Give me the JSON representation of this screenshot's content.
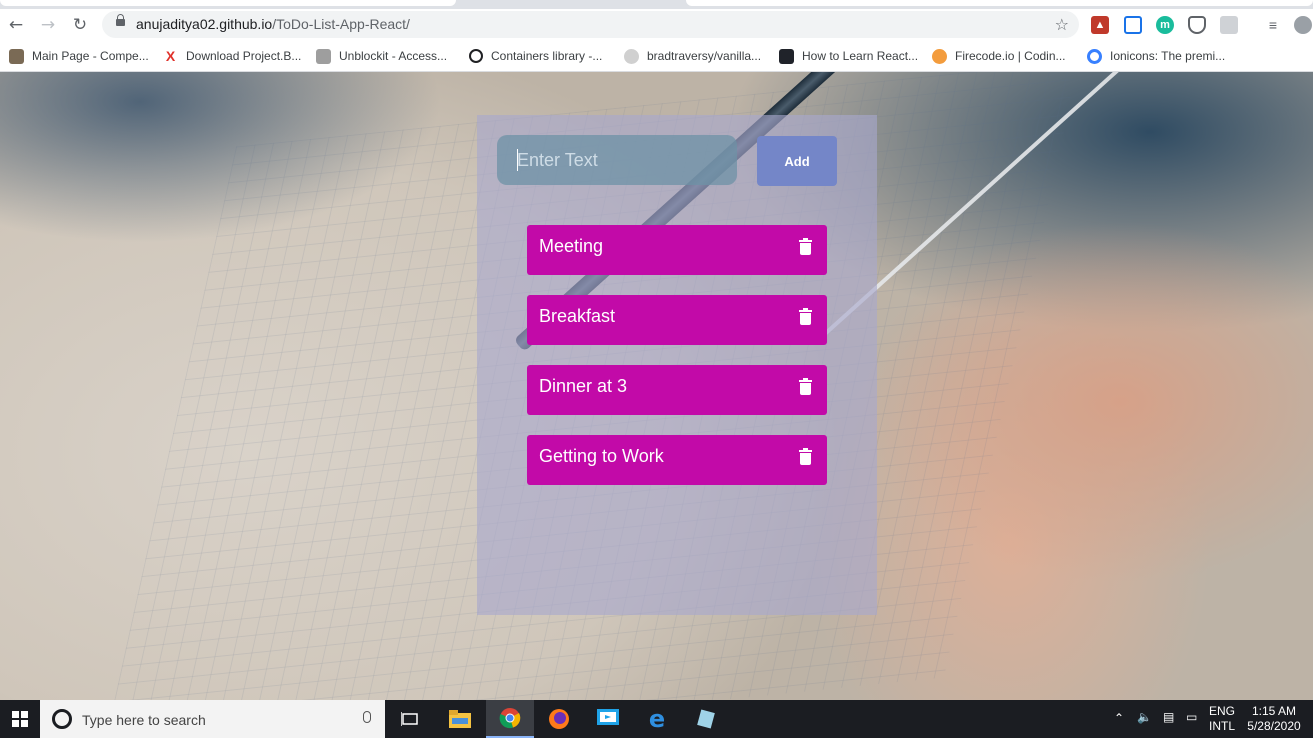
{
  "browser": {
    "url_host": "anujaditya02.github.io",
    "url_path": "/ToDo-List-App-React/",
    "bookmarks": [
      {
        "label": "Main Page - Compe...",
        "icon": "wiki-icon"
      },
      {
        "label": "Download Project.B...",
        "icon": "x-logo-icon"
      },
      {
        "label": "Unblockit - Access...",
        "icon": "unblockit-icon"
      },
      {
        "label": "Containers library -...",
        "icon": "containers-icon"
      },
      {
        "label": "bradtraversy/vanilla...",
        "icon": "github-icon"
      },
      {
        "label": "How to Learn React...",
        "icon": "react-icon"
      },
      {
        "label": "Firecode.io | Codin...",
        "icon": "firecode-icon"
      },
      {
        "label": "Ionicons: The premi...",
        "icon": "ionicons-icon"
      }
    ]
  },
  "todo": {
    "input_placeholder": "Enter Text",
    "add_label": "Add",
    "items": [
      {
        "text": "Meeting"
      },
      {
        "text": "Breakfast"
      },
      {
        "text": "Dinner at 3"
      },
      {
        "text": "Getting to Work"
      }
    ],
    "item_color": "#c20aa8",
    "button_color": "#7486c8"
  },
  "taskbar": {
    "search_placeholder": "Type here to search",
    "language": "ENG",
    "layout": "INTL",
    "time": "1:15 AM",
    "date": "5/28/2020"
  }
}
